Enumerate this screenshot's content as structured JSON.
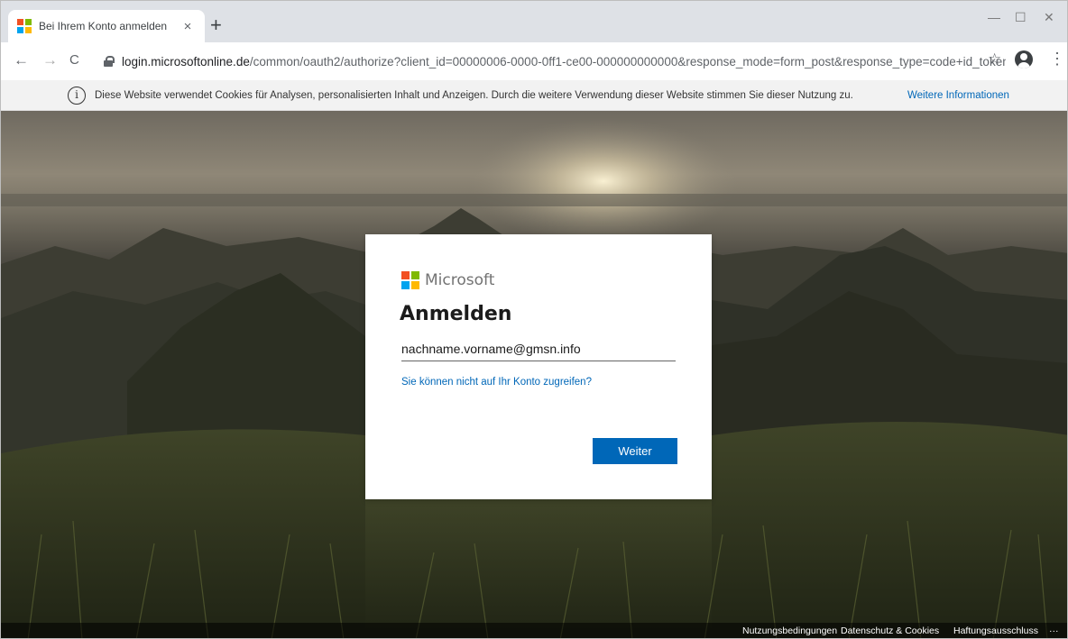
{
  "browser": {
    "tab_title": "Bei Ihrem Konto anmelden",
    "tab_close": "×",
    "new_tab": "+",
    "url_host": "login.microsoftonline.de",
    "url_path": "/common/oauth2/authorize?client_id=00000006-0000-0ff1-ce00-000000000000&response_mode=form_post&response_type=code+id_token&scope...",
    "window_controls": {
      "minimize": "—",
      "maximize": "☐",
      "close": "✕"
    },
    "nav": {
      "back": "←",
      "forward": "→",
      "reload": "C"
    },
    "star": "☆",
    "menu": "⋮"
  },
  "cookie_bar": {
    "icon": "i",
    "text": "Diese Website verwendet Cookies für Analysen, personalisierten Inhalt und Anzeigen. Durch die weitere Verwendung dieser Website stimmen Sie dieser Nutzung zu.",
    "link": "Weitere Informationen"
  },
  "signin": {
    "brand": "Microsoft",
    "heading": "Anmelden",
    "email_value": "nachname.vorname@gmsn.info",
    "cant_access": "Sie können nicht auf Ihr Konto zugreifen?",
    "next_button": "Weiter"
  },
  "footer": {
    "terms": "Nutzungsbedingungen",
    "privacy": "Datenschutz & Cookies",
    "disclaimer": "Haftungsausschluss",
    "more": "···"
  },
  "colors": {
    "ms_red": "#f25022",
    "ms_green": "#7fba00",
    "ms_blue": "#00a4ef",
    "ms_yellow": "#ffb900",
    "accent": "#0067b8"
  }
}
